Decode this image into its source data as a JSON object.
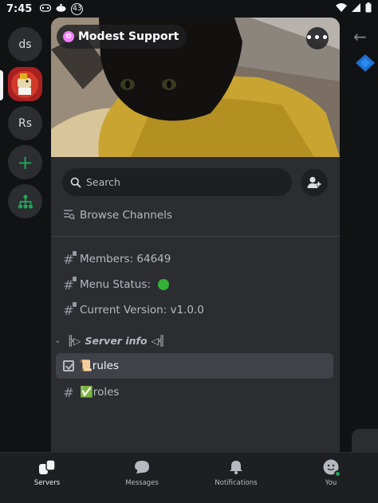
{
  "status_bar": {
    "time": "7:45",
    "badge": "43"
  },
  "servers": [
    {
      "label": "ds"
    },
    {
      "label": ""
    },
    {
      "label": "Rs"
    },
    {
      "label": "+"
    },
    {
      "label": ""
    }
  ],
  "server": {
    "name": "Modest Support",
    "more": "•••"
  },
  "search": {
    "placeholder": "Search"
  },
  "browse": {
    "label": "Browse Channels"
  },
  "channels": {
    "members": "Members: 64649",
    "menu_status": "Menu Status: ",
    "current_version": "Current Version: v1.0.0"
  },
  "category": {
    "prefix": "╠▷",
    "name": "Server info",
    "suffix": "◁╣"
  },
  "text_channels": {
    "rules": "📜rules",
    "roles": "✅roles"
  },
  "bottom_nav": {
    "servers": "Servers",
    "messages": "Messages",
    "notifications": "Notifications",
    "you": "You"
  },
  "colors": {
    "accent_green": "#23a55a",
    "status_green": "#35b035",
    "selected_row": "#404249",
    "panel": "#2b2d31"
  },
  "icons": {
    "search": "search-icon",
    "invite": "add-member-icon",
    "browse": "browse-channels-icon",
    "back": "arrow-left-icon"
  }
}
